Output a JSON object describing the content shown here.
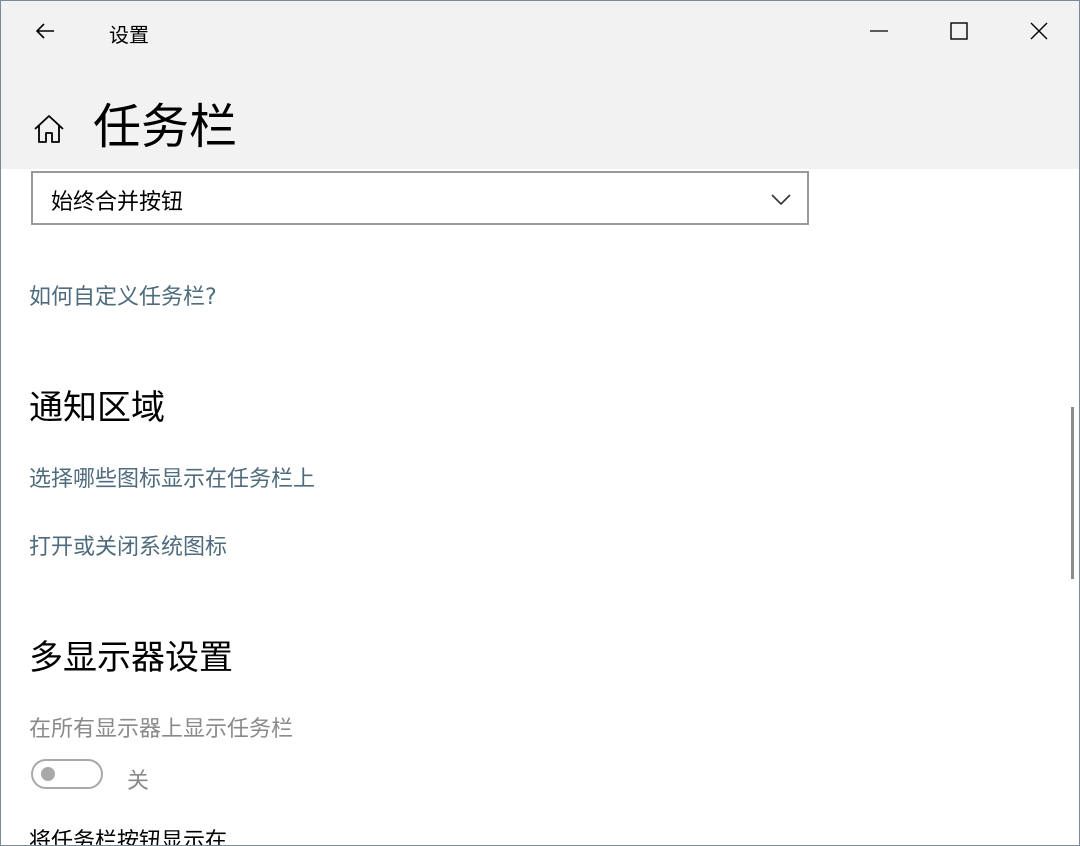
{
  "window": {
    "app_title": "设置",
    "controls": {
      "minimize_icon": "minimize-icon",
      "maximize_icon": "maximize-icon",
      "close_icon": "close-icon"
    }
  },
  "header": {
    "back_icon": "arrow-left-icon",
    "home_icon": "home-icon",
    "page_title": "任务栏"
  },
  "combine_dropdown": {
    "value": "始终合并按钮",
    "icon": "chevron-down-icon"
  },
  "links": {
    "customize": "如何自定义任务栏?"
  },
  "notification_area": {
    "title": "通知区域",
    "link_icons": "选择哪些图标显示在任务栏上",
    "link_system_icons": "打开或关闭系统图标"
  },
  "multi_display": {
    "title": "多显示器设置",
    "show_all_label": "在所有显示器上显示任务栏",
    "toggle_state": "关",
    "toggle_on": false,
    "next_label": "将任务栏按钮显示在"
  },
  "colors": {
    "link": "#4f6b7e",
    "titlebar_bg": "#f2f2f2",
    "disabled": "#8a8a8a"
  }
}
